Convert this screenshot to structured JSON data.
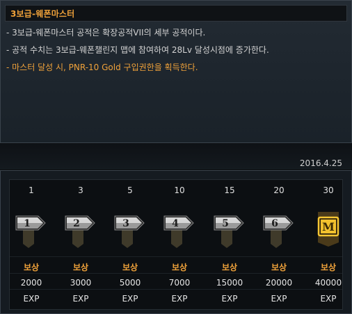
{
  "title": "3보급-웨폰마스터",
  "description": [
    "- 3보급-웨폰마스터 공적은 확장공적VII의 세부 공적이다.",
    "- 공적 수치는 3보급-웨폰챌린지 맵에 참여하여 28Lv 달성시점에 증가한다.",
    "- 마스터 달성 시, PNR-10 Gold 구입권한을 획득한다."
  ],
  "date": "2016.4.25",
  "tiers": [
    {
      "level": "1",
      "badge": "1",
      "reward_label": "보상",
      "exp_value": "2000",
      "exp_unit": "EXP"
    },
    {
      "level": "3",
      "badge": "2",
      "reward_label": "보상",
      "exp_value": "3000",
      "exp_unit": "EXP"
    },
    {
      "level": "5",
      "badge": "3",
      "reward_label": "보상",
      "exp_value": "5000",
      "exp_unit": "EXP"
    },
    {
      "level": "10",
      "badge": "4",
      "reward_label": "보상",
      "exp_value": "7000",
      "exp_unit": "EXP"
    },
    {
      "level": "15",
      "badge": "5",
      "reward_label": "보상",
      "exp_value": "15000",
      "exp_unit": "EXP"
    },
    {
      "level": "20",
      "badge": "6",
      "reward_label": "보상",
      "exp_value": "20000",
      "exp_unit": "EXP"
    },
    {
      "level": "30",
      "badge": "M",
      "reward_label": "보상",
      "exp_value": "40000",
      "exp_unit": "EXP"
    }
  ],
  "colors": {
    "accent": "#f0a23a",
    "badge_silver": "#c9c9c9",
    "badge_gold": "#f2c12e"
  }
}
